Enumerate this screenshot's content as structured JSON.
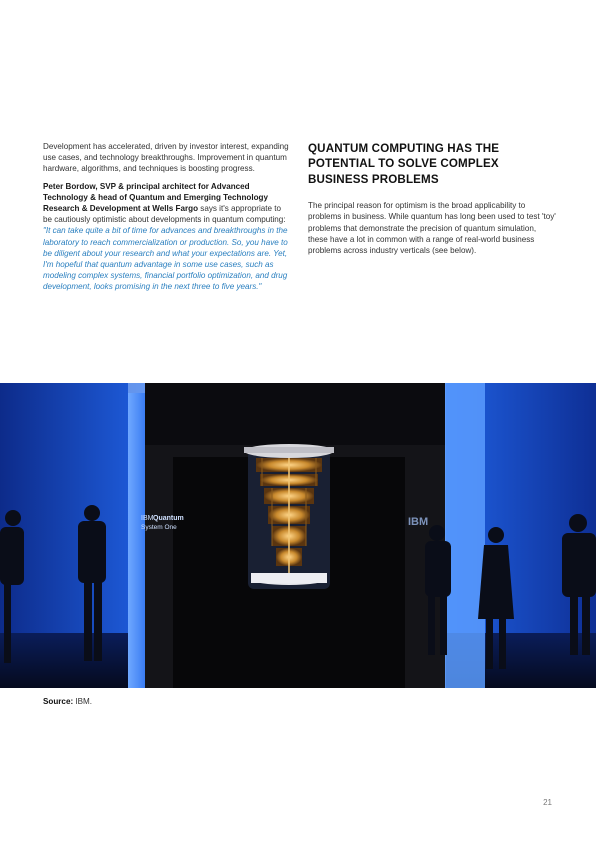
{
  "left_column": {
    "intro": "Development has accelerated, driven by investor interest, expanding use cases, and technology breakthroughs. Improvement in quantum hardware, algorithms, and techniques is boosting progress.",
    "speaker": "Peter Bordow, SVP & principal architect for Advanced Technology & head of Quantum and Emerging Technology Research & Development at Wells Fargo",
    "lead_in": "says it's appropriate to be cautiously optimistic about developments in quantum computing:",
    "quote": "\"It can take quite a bit of time for advances and breakthroughs in the laboratory to reach commercialization or production. So, you have to be diligent about your research and what your expectations are. Yet, I'm hopeful that quantum advantage in some use cases, such as modeling complex systems, financial portfolio optimization, and drug development, looks promising in the next three to five years.\""
  },
  "right_column": {
    "heading": "QUANTUM COMPUTING HAS THE POTENTIAL TO SOLVE COMPLEX BUSINESS PROBLEMS",
    "body": "The principal reason for optimism is the broad applicability to problems in business. While quantum has long been used to test 'toy' problems that demonstrate the precision of quantum simulation, these have a lot in common with a range of real-world business problems across industry verticals (see below)."
  },
  "photo": {
    "wall_text_left_1": "IBM",
    "wall_text_left_2": "Quantum",
    "wall_text_left_3": "System One",
    "wall_text_right": "IBM",
    "colors": {
      "blue": "#1f5fe0",
      "gold": "#d9a14a",
      "dark": "#0b0b0f"
    }
  },
  "source": {
    "label": "Source:",
    "value": "IBM."
  },
  "page_number": "21"
}
